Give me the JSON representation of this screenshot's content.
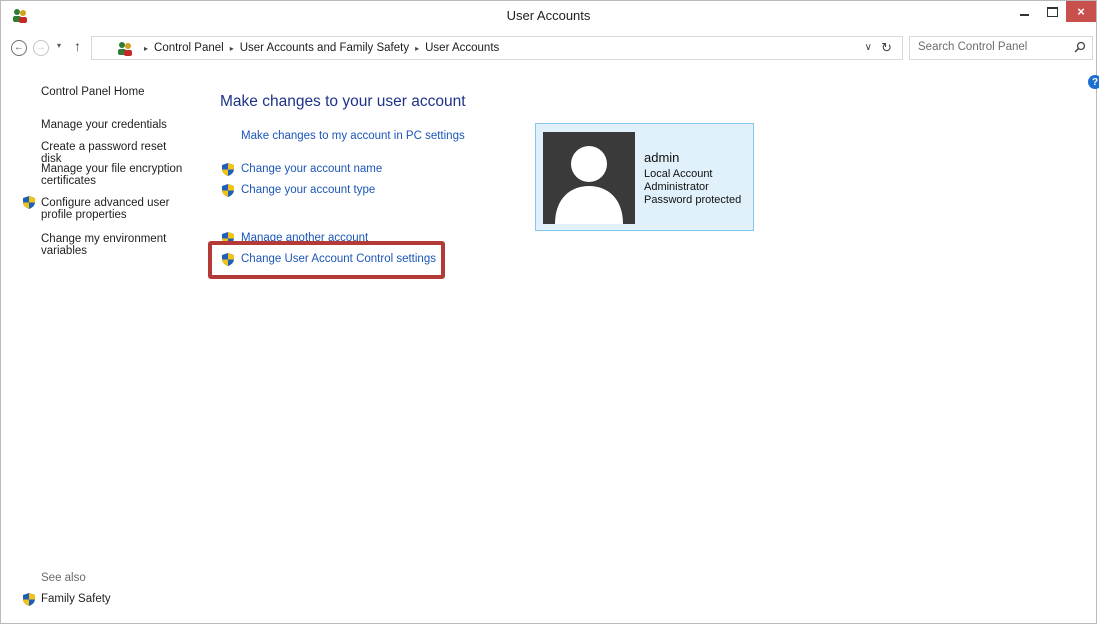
{
  "window": {
    "title": "User Accounts",
    "close_glyph": "×"
  },
  "nav": {
    "back_glyph": "←",
    "forward_glyph": "→",
    "recent_glyph": "▾",
    "up_glyph": "↑",
    "breadcrumbs": [
      "Control Panel",
      "User Accounts and Family Safety",
      "User Accounts"
    ],
    "separator": "▸",
    "dropdown_glyph": "∨",
    "refresh_glyph": "↻",
    "search_placeholder": "Search Control Panel"
  },
  "help_glyph": "?",
  "left_pane": {
    "home": "Control Panel Home",
    "items": [
      "Manage your credentials",
      "Create a password reset disk",
      "Manage your file encryption certificates",
      "Configure advanced user profile properties",
      "Change my environment variables"
    ],
    "see_also": "See also",
    "family_safety": "Family Safety"
  },
  "main": {
    "heading": "Make changes to your user account",
    "links": {
      "pc_settings": "Make changes to my account in PC settings",
      "change_name": "Change your account name",
      "change_type": "Change your account type",
      "manage_another": "Manage another account",
      "uac_settings": "Change User Account Control settings"
    }
  },
  "account": {
    "name": "admin",
    "type": "Local Account",
    "role": "Administrator",
    "status": "Password protected"
  },
  "colors": {
    "link": "#1c56b8",
    "heading": "#1e3287",
    "highlight": "#b43a37",
    "tile_bg": "#e1f1fb",
    "close_button": "#c7504d"
  }
}
